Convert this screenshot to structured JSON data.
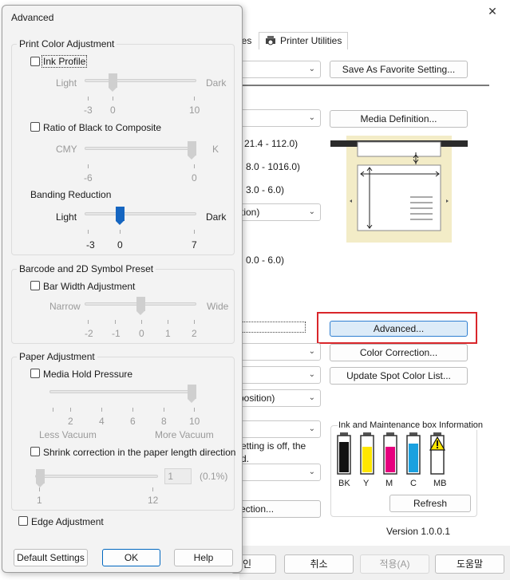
{
  "back": {
    "close_glyph": "✕",
    "tab_partial": "ies",
    "tab_printer_utilities": "Printer Utilities",
    "save_favorite": "Save As Favorite Setting...",
    "media_definition": "Media Definition...",
    "range1": "21.4 - 112.0)",
    "range2": "8.0 - 1016.0)",
    "range3": "3.0 -   6.0)",
    "combo_tion": "tion)",
    "range4": "0.0 -   6.0)",
    "advanced": "Advanced...",
    "color_correction": "Color Correction...",
    "update_spot": "Update Spot Color List...",
    "combo_position": "position)",
    "text_etting": "etting is off, the",
    "text_d": "d.",
    "ection": "ection...",
    "ink_title": "Ink and Maintenance box Information",
    "inks": [
      "BK",
      "Y",
      "M",
      "C",
      "MB"
    ],
    "refresh": "Refresh",
    "version": "Version 1.0.0.1",
    "btn_in": "인",
    "btn_cancel": "취소",
    "btn_apply": "적용(A)",
    "btn_help": "도움말",
    "colors": {
      "accent_red": "#d9262b",
      "black": "#111111",
      "yellow": "#ffe600",
      "magenta": "#e6007e",
      "cyan": "#1aa1e0"
    }
  },
  "dialog": {
    "title": "Advanced",
    "print_color": {
      "title": "Print Color Adjustment",
      "ink_profile": {
        "label": "Ink Profile",
        "checked": false
      },
      "slider1": {
        "left": "Light",
        "right": "Dark",
        "ticks": [
          "-3",
          "0",
          "10"
        ]
      },
      "ratio": {
        "label": "Ratio of Black to Composite",
        "checked": false
      },
      "slider2": {
        "left": "CMY",
        "right": "K",
        "ticks": [
          "-6",
          "0"
        ]
      },
      "banding": {
        "label": "Banding Reduction",
        "left": "Light",
        "right": "Dark",
        "ticks": [
          "-3",
          "0",
          "7"
        ],
        "value": 0
      }
    },
    "barcode": {
      "title": "Barcode and 2D Symbol Preset",
      "bar_width": {
        "label": "Bar Width Adjustment",
        "checked": false
      },
      "slider": {
        "left": "Narrow",
        "right": "Wide",
        "ticks": [
          "-2",
          "-1",
          "0",
          "1",
          "2"
        ]
      }
    },
    "paper": {
      "title": "Paper Adjustment",
      "hold": {
        "label": "Media Hold Pressure",
        "checked": false
      },
      "hold_ticks": [
        "2",
        "4",
        "6",
        "8",
        "10"
      ],
      "hold_left": "Less Vacuum",
      "hold_right": "More Vacuum",
      "shrink": {
        "label": "Shrink correction in the paper length direction",
        "checked": false
      },
      "shrink_value": "1",
      "shrink_unit": "(0.1%)",
      "shrink_ticks": [
        "1",
        "12"
      ]
    },
    "edge": {
      "label": "Edge Adjustment",
      "checked": false
    },
    "buttons": {
      "default": "Default Settings",
      "ok": "OK",
      "help": "Help"
    }
  }
}
